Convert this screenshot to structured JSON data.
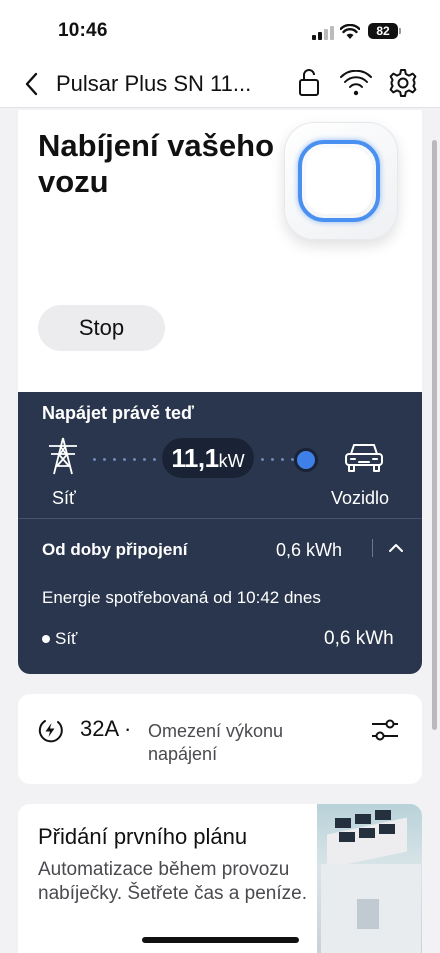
{
  "status_bar": {
    "time": "10:46",
    "battery": "82"
  },
  "nav": {
    "title": "Pulsar Plus SN 11...",
    "icons": [
      "chevron-left-icon",
      "lock-icon",
      "wifi-icon",
      "gear-icon"
    ]
  },
  "hero": {
    "title": "Nabíjení vašeho vozu",
    "stop_label": "Stop"
  },
  "power_panel": {
    "now_label": "Napájet právě teď",
    "grid_label": "Síť",
    "vehicle_label": "Vozidlo",
    "power_value": "11,1",
    "power_unit": "kW",
    "since_label": "Od doby připojení",
    "since_value": "0,6 kWh",
    "energy_description": "Energie spotřebovaná od 10:42 dnes",
    "source_label": "Síť",
    "source_value": "0,6 kWh"
  },
  "limit_card": {
    "amps": "32A ·",
    "label": "Omezení výkonu napájení"
  },
  "plan_card": {
    "title": "Přidání prvního plánu",
    "description": "Automatizace během provozu nabíječky. Šetřete čas a peníze."
  },
  "colors": {
    "panel_bg": "#2a364d",
    "accent_blue": "#3e7fe8",
    "page_bg": "#f2f2f4"
  }
}
